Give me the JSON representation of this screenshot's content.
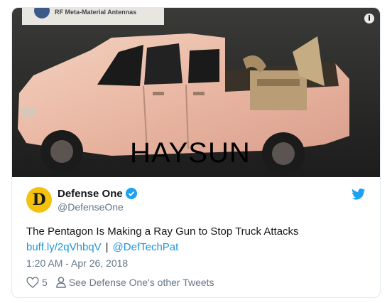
{
  "media": {
    "sign_text": "RF Meta-Material Antennas",
    "watermark": "HAYSUN"
  },
  "author": {
    "avatar_letter": "D",
    "display_name": "Defense One",
    "handle": "@DefenseOne"
  },
  "tweet": {
    "text": "The Pentagon Is Making a Ray Gun to Stop Truck Attacks",
    "link1": "buff.ly/2qVhbqV",
    "separator": "|",
    "link2": "@DefTechPat",
    "timestamp": "1:20 AM - Apr 26, 2018"
  },
  "actions": {
    "like_count": "5",
    "profile_link": "See Defense One's other Tweets"
  },
  "colors": {
    "link": "#1b95e0",
    "secondary_text": "#657786",
    "avatar_bg": "#f4c20d"
  },
  "icons": [
    "info-icon",
    "verified-icon",
    "twitter-bird-icon",
    "heart-icon",
    "person-icon"
  ]
}
